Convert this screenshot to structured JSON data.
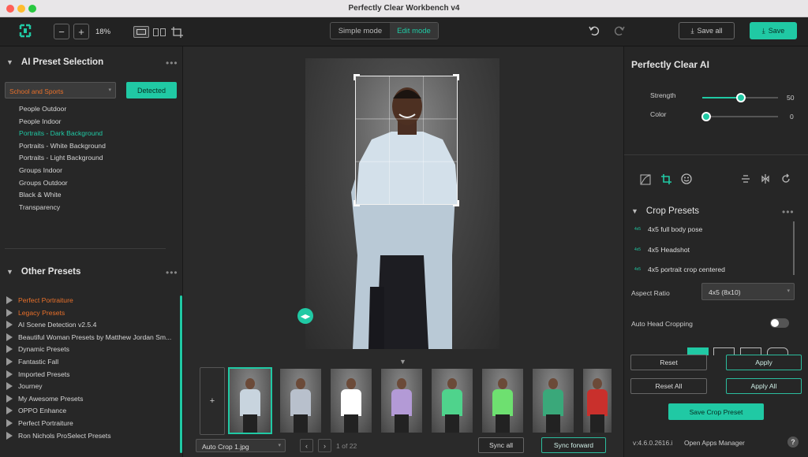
{
  "window": {
    "title": "Perfectly Clear Workbench v4"
  },
  "toolbar": {
    "zoom": "18%",
    "modes": [
      "Simple mode",
      "Edit mode"
    ],
    "save_all_label": "Save all",
    "save_label": "Save"
  },
  "left_panel": {
    "ai_preset_title": "AI Preset Selection",
    "dropdown_value": "School and Sports",
    "detected_label": "Detected",
    "presets": [
      "People Outdoor",
      "People Indoor",
      "Portraits - Dark Background",
      "Portraits - White Background",
      "Portraits - Light Background",
      "Groups Indoor",
      "Groups Outdoor",
      "Black & White",
      "Transparency"
    ],
    "active_preset_index": 2,
    "other_title": "Other Presets",
    "other_presets": [
      "Perfect Portraiture",
      "Legacy Presets",
      "AI Scene Detection v2.5.4",
      "Beautiful Woman Presets by Matthew Jordan Sm...",
      "Dynamic Presets",
      "Fantastic Fall",
      "Imported Presets",
      "Journey",
      "My Awesome Presets",
      "OPPO Enhance",
      "Perfect Portraiture",
      "Ron Nichols ProSelect Presets"
    ]
  },
  "filmstrip": {
    "add_label": "+",
    "file_select": "Auto Crop 1.jpg",
    "page_info": "1 of 22",
    "sync_all_label": "Sync all",
    "sync_forward_label": "Sync forward"
  },
  "right_panel": {
    "ai_title": "Perfectly Clear AI",
    "strength_label": "Strength",
    "strength_value": "50",
    "color_label": "Color",
    "color_value": "0",
    "crop_title": "Crop Presets",
    "crop_presets": [
      {
        "badge": "4x5",
        "label": "4x5 full body pose"
      },
      {
        "badge": "4x5",
        "label": "4x5 Headshot"
      },
      {
        "badge": "4x5",
        "label": "4x5 portrait crop centered"
      }
    ],
    "aspect_label": "Aspect Ratio",
    "aspect_value": "4x5 (8x10)",
    "auto_head_label": "Auto Head Cropping",
    "reset_label": "Reset",
    "apply_label": "Apply",
    "reset_all_label": "Reset All",
    "apply_all_label": "Apply All",
    "save_crop_label": "Save Crop Preset",
    "version": "v:4.6.0.2616.i",
    "apps_manager": "Open Apps Manager",
    "help": "?"
  },
  "colors": {
    "accent": "#20c9a4",
    "orange": "#e8702a",
    "panel": "#272727"
  }
}
